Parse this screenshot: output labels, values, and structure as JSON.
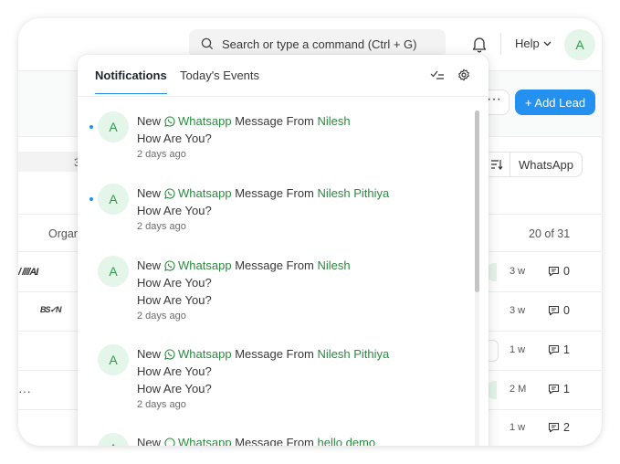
{
  "navbar": {
    "search_placeholder": "Search or type a command (Ctrl + G)",
    "help_label": "Help",
    "avatar_initial": "A"
  },
  "background": {
    "more_label": "···",
    "add_lead_label": "+ Add Lead",
    "whatsapp_view_label": "WhatsApp",
    "column_header": "Organ",
    "stripe_text": "3",
    "count_label": "20 of 31",
    "rows": [
      {
        "logo": "/ ////AI",
        "time": "3 w",
        "comments": "0"
      },
      {
        "logo": "BS✓N",
        "time": "3 w",
        "comments": "0"
      },
      {
        "logo": "",
        "time": "1 w",
        "comments": "1"
      },
      {
        "logo": "···",
        "time": "2 M",
        "comments": "1"
      },
      {
        "logo": "",
        "time": "1 w",
        "comments": "2"
      }
    ]
  },
  "panel": {
    "tabs": {
      "notifications": "Notifications",
      "events": "Today's Events"
    },
    "notifications": [
      {
        "unread": true,
        "avatar": "A",
        "prefix": "New",
        "channel": "Whatsapp",
        "middle": "Message From",
        "sender": "Nilesh",
        "messages": [
          "How Are You?"
        ],
        "time": "2 days ago"
      },
      {
        "unread": true,
        "avatar": "A",
        "prefix": "New",
        "channel": "Whatsapp",
        "middle": "Message From",
        "sender": "Nilesh Pithiya",
        "messages": [
          "How Are You?"
        ],
        "time": "2 days ago"
      },
      {
        "unread": false,
        "avatar": "A",
        "prefix": "New",
        "channel": "Whatsapp",
        "middle": "Message From",
        "sender": "Nilesh",
        "messages": [
          "How Are You?",
          "How Are You?"
        ],
        "time": "2 days ago"
      },
      {
        "unread": false,
        "avatar": "A",
        "prefix": "New",
        "channel": "Whatsapp",
        "middle": "Message From",
        "sender": "Nilesh Pithiya",
        "messages": [
          "How Are You?",
          "How Are You?"
        ],
        "time": "2 days ago"
      },
      {
        "unread": false,
        "avatar": "A",
        "prefix": "New",
        "channel": "Whatsapp",
        "middle": "Message From",
        "sender": "hello demo",
        "messages": [],
        "time": ""
      }
    ]
  },
  "colors": {
    "accent": "#2490ef",
    "whatsapp_green": "#2b8a3e",
    "avatar_bg": "#e4f5e9"
  }
}
